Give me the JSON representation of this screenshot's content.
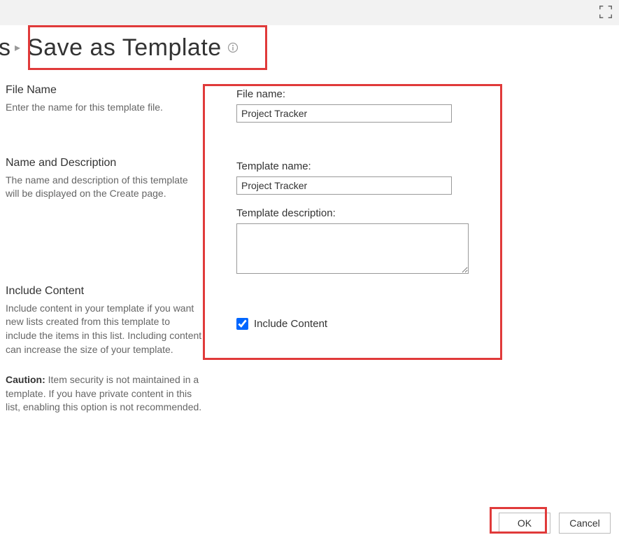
{
  "breadcrumb": {
    "prev_fragment": "s",
    "separator": "▸"
  },
  "page": {
    "title": "Save as Template"
  },
  "left": {
    "file_name": {
      "heading": "File Name",
      "desc": "Enter the name for this template file."
    },
    "name_desc": {
      "heading": "Name and Description",
      "desc": "The name and description of this template will be displayed on the Create page."
    },
    "include": {
      "heading": "Include Content",
      "desc": "Include content in your template if you want new lists created from this template to include the items in this list. Including content can increase the size of your template.",
      "caution_label": "Caution:",
      "caution_text": " Item security is not maintained in a template. If you have private content in this list, enabling this option is not recommended."
    }
  },
  "fields": {
    "file_name_label": "File name:",
    "file_name_value": "Project Tracker",
    "template_name_label": "Template name:",
    "template_name_value": "Project Tracker",
    "template_desc_label": "Template description:",
    "template_desc_value": "",
    "include_content_label": "Include Content",
    "include_content_checked": true
  },
  "buttons": {
    "ok": "OK",
    "cancel": "Cancel"
  }
}
